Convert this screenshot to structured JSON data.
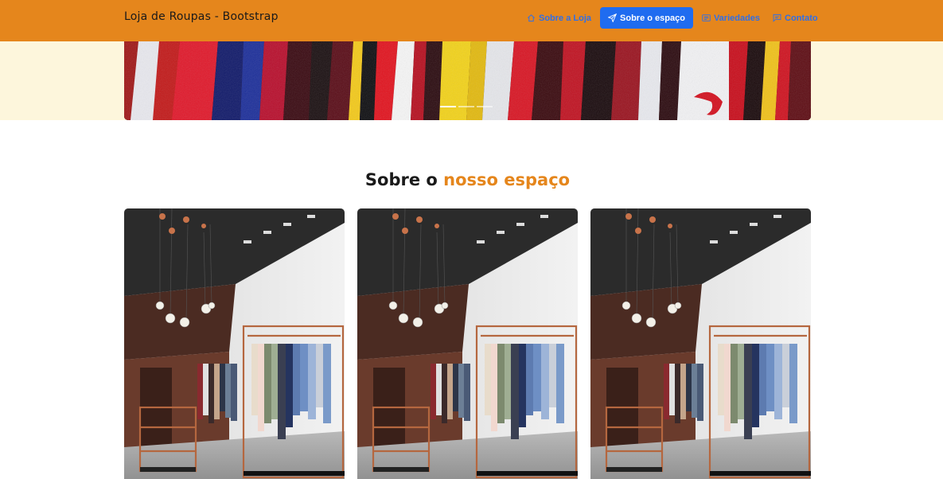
{
  "navbar": {
    "brand": "Loja de Roupas - Bootstrap",
    "items": [
      {
        "label": "Sobre a Loja",
        "icon": "house-icon",
        "active": false
      },
      {
        "label": "Sobre o espaço",
        "icon": "send-icon",
        "active": true
      },
      {
        "label": "Variedades",
        "icon": "card-text-icon",
        "active": false
      },
      {
        "label": "Contato",
        "icon": "chat-icon",
        "active": false
      }
    ],
    "colors": {
      "background": "#e5861c",
      "link": "#2f6fe8",
      "active_bg": "#1f6cf0"
    }
  },
  "carousel": {
    "image": "hanging-colorful-shirts",
    "slide_count": 3,
    "active_slide": 1
  },
  "section": {
    "title_prefix": "Sobre o",
    "title_accent": "nosso espaço",
    "accent_color": "#e5861c"
  },
  "gallery": {
    "images": [
      "clothing-store-interior",
      "clothing-store-interior",
      "clothing-store-interior"
    ]
  }
}
